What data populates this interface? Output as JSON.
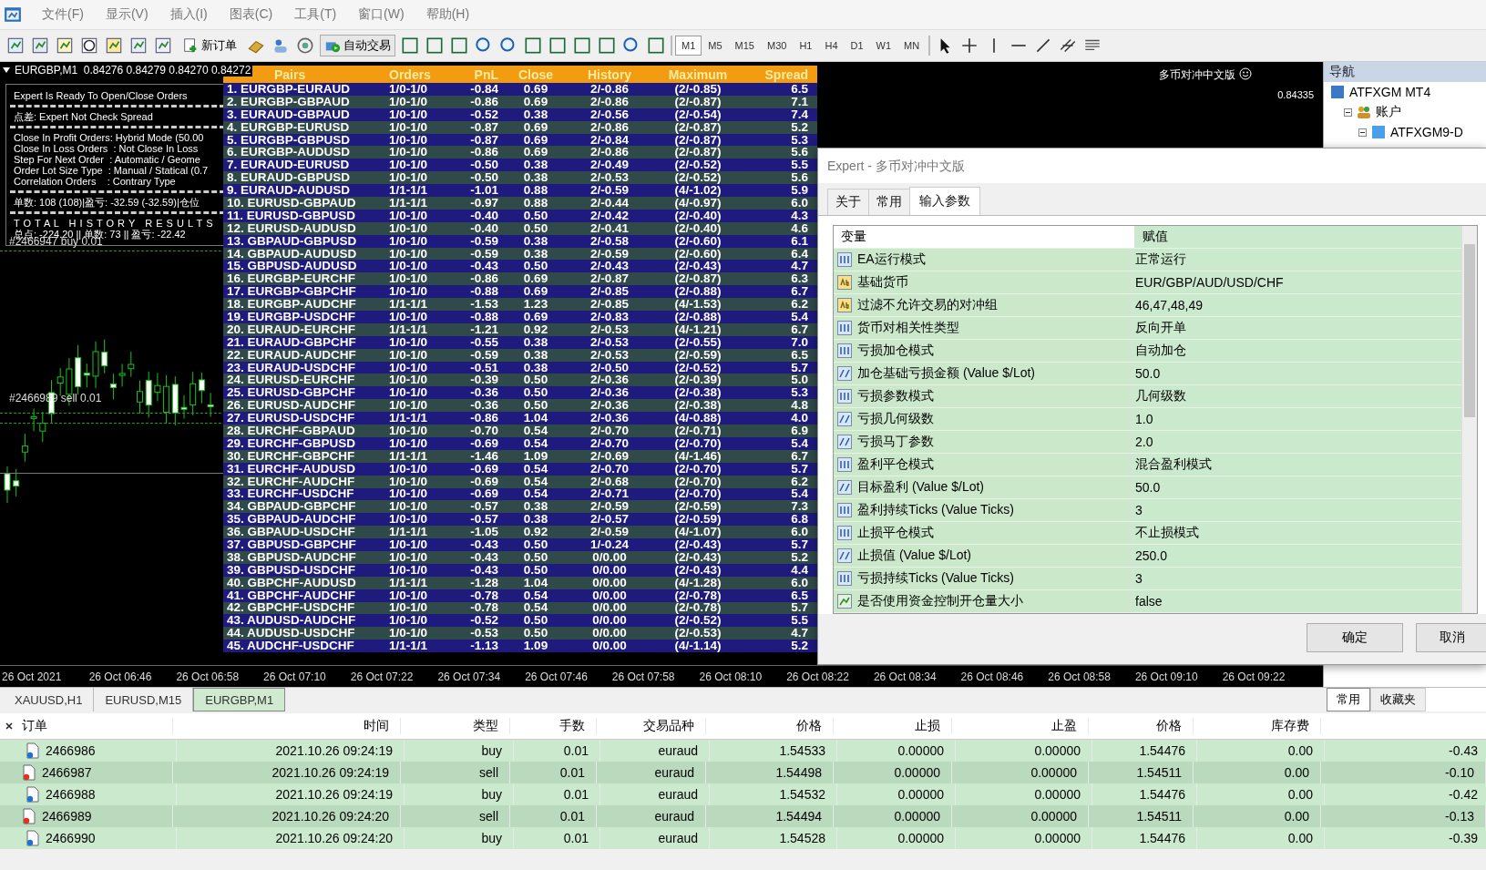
{
  "menu": [
    "文件(F)",
    "显示(V)",
    "插入(I)",
    "图表(C)",
    "工具(T)",
    "窗口(W)",
    "帮助(H)"
  ],
  "toolbar": {
    "new_order": "新订单",
    "auto_trading": "自动交易",
    "timeframes": [
      {
        "label": "M1",
        "selected": true
      },
      {
        "label": "M5",
        "selected": false
      },
      {
        "label": "M15",
        "selected": false
      },
      {
        "label": "M30",
        "selected": false
      },
      {
        "label": "H1",
        "selected": false
      },
      {
        "label": "H4",
        "selected": false
      },
      {
        "label": "D1",
        "selected": false
      },
      {
        "label": "W1",
        "selected": false
      },
      {
        "label": "MN",
        "selected": false
      }
    ]
  },
  "chart": {
    "title": "EURGBP,M1  0.84276 0.84279 0.84270 0.84272",
    "expert_name": "多币对冲中文版",
    "price_label": "0.84335",
    "info_sections": [
      [
        "Expert Is Ready To Open/Close Orders"
      ],
      [
        "点差: Expert Not Check Spread"
      ],
      [
        "Close In Profit Orders: Hybrid Mode (50.00",
        "Close In Loss Orders  : Not Close In Loss",
        "Step For Next Order  : Automatic / Geome",
        "Order Lot Size Type  : Manual / Statical (0.7",
        "Correlation Orders    : Contrary Type"
      ],
      [
        "单数: 108 (108)|盈亏: -32.59 (-32.59)|仓位"
      ],
      [
        "T O T A L   H I S T O R Y   R E S U L T S",
        "总点: -224.20 || 单数: 73 || 盈亏: -22.42"
      ]
    ],
    "order_labels": [
      "#2466947 buy 0.01",
      "#2466989 sell 0.01"
    ],
    "time_labels": [
      "26 Oct 2021",
      "26 Oct 06:46",
      "26 Oct 06:58",
      "26 Oct 07:10",
      "26 Oct 07:22",
      "26 Oct 07:34",
      "26 Oct 07:46",
      "26 Oct 07:58",
      "26 Oct 08:10",
      "26 Oct 08:22",
      "26 Oct 08:34",
      "26 Oct 08:46",
      "26 Oct 08:58",
      "26 Oct 09:10",
      "26 Oct 09:22"
    ],
    "table": {
      "columns": [
        "Pairs",
        "Orders",
        "PnL",
        "Close",
        "History",
        "Maximum",
        "Spread"
      ],
      "rows": [
        [
          "1. EURGBP-EURAUD",
          "1/0-1/0",
          "-0.84",
          "0.69",
          "2/-0.86",
          "(2/-0.85)",
          "6.5"
        ],
        [
          "2. EURGBP-GBPAUD",
          "1/0-1/0",
          "-0.86",
          "0.69",
          "2/-0.86",
          "(2/-0.87)",
          "7.1"
        ],
        [
          "3. EURAUD-GBPAUD",
          "1/0-1/0",
          "-0.52",
          "0.38",
          "2/-0.56",
          "(2/-0.54)",
          "7.4"
        ],
        [
          "4. EURGBP-EURUSD",
          "1/0-1/0",
          "-0.87",
          "0.69",
          "2/-0.86",
          "(2/-0.87)",
          "5.2"
        ],
        [
          "5. EURGBP-GBPUSD",
          "1/0-1/0",
          "-0.87",
          "0.69",
          "2/-0.84",
          "(2/-0.87)",
          "5.3"
        ],
        [
          "6. EURGBP-AUDUSD",
          "1/0-1/0",
          "-0.86",
          "0.69",
          "2/-0.86",
          "(2/-0.87)",
          "5.6"
        ],
        [
          "7. EURAUD-EURUSD",
          "1/0-1/0",
          "-0.50",
          "0.38",
          "2/-0.49",
          "(2/-0.52)",
          "5.5"
        ],
        [
          "8. EURAUD-GBPUSD",
          "1/0-1/0",
          "-0.50",
          "0.38",
          "2/-0.53",
          "(2/-0.52)",
          "5.6"
        ],
        [
          "9. EURAUD-AUDUSD",
          "1/1-1/1",
          "-1.01",
          "0.88",
          "2/-0.59",
          "(4/-1.02)",
          "5.9"
        ],
        [
          "10. EURUSD-GBPAUD",
          "1/1-1/1",
          "-0.97",
          "0.88",
          "2/-0.44",
          "(4/-0.97)",
          "6.0"
        ],
        [
          "11. EURUSD-GBPUSD",
          "1/0-1/0",
          "-0.40",
          "0.50",
          "2/-0.42",
          "(2/-0.40)",
          "4.3"
        ],
        [
          "12. EURUSD-AUDUSD",
          "1/0-1/0",
          "-0.40",
          "0.50",
          "2/-0.41",
          "(2/-0.40)",
          "4.6"
        ],
        [
          "13. GBPAUD-GBPUSD",
          "1/0-1/0",
          "-0.59",
          "0.38",
          "2/-0.58",
          "(2/-0.60)",
          "6.1"
        ],
        [
          "14. GBPAUD-AUDUSD",
          "1/0-1/0",
          "-0.59",
          "0.38",
          "2/-0.59",
          "(2/-0.60)",
          "6.4"
        ],
        [
          "15. GBPUSD-AUDUSD",
          "1/0-1/0",
          "-0.43",
          "0.50",
          "2/-0.43",
          "(2/-0.43)",
          "4.7"
        ],
        [
          "16. EURGBP-EURCHF",
          "1/0-1/0",
          "-0.86",
          "0.69",
          "2/-0.87",
          "(2/-0.87)",
          "6.3"
        ],
        [
          "17. EURGBP-GBPCHF",
          "1/0-1/0",
          "-0.88",
          "0.69",
          "2/-0.85",
          "(2/-0.88)",
          "6.7"
        ],
        [
          "18. EURGBP-AUDCHF",
          "1/1-1/1",
          "-1.53",
          "1.23",
          "2/-0.85",
          "(4/-1.53)",
          "6.2"
        ],
        [
          "19. EURGBP-USDCHF",
          "1/0-1/0",
          "-0.88",
          "0.69",
          "2/-0.83",
          "(2/-0.88)",
          "5.4"
        ],
        [
          "20. EURAUD-EURCHF",
          "1/1-1/1",
          "-1.21",
          "0.92",
          "2/-0.53",
          "(4/-1.21)",
          "6.7"
        ],
        [
          "21. EURAUD-GBPCHF",
          "1/0-1/0",
          "-0.55",
          "0.38",
          "2/-0.53",
          "(2/-0.55)",
          "7.0"
        ],
        [
          "22. EURAUD-AUDCHF",
          "1/0-1/0",
          "-0.59",
          "0.38",
          "2/-0.53",
          "(2/-0.59)",
          "6.5"
        ],
        [
          "23. EURAUD-USDCHF",
          "1/0-1/0",
          "-0.51",
          "0.38",
          "2/-0.50",
          "(2/-0.52)",
          "5.7"
        ],
        [
          "24. EURUSD-EURCHF",
          "1/0-1/0",
          "-0.39",
          "0.50",
          "2/-0.36",
          "(2/-0.39)",
          "5.0"
        ],
        [
          "25. EURUSD-GBPCHF",
          "1/0-1/0",
          "-0.36",
          "0.50",
          "2/-0.36",
          "(2/-0.38)",
          "5.3"
        ],
        [
          "26. EURUSD-AUDCHF",
          "1/0-1/0",
          "-0.36",
          "0.50",
          "2/-0.36",
          "(2/-0.38)",
          "4.8"
        ],
        [
          "27. EURUSD-USDCHF",
          "1/1-1/1",
          "-0.86",
          "1.04",
          "2/-0.36",
          "(4/-0.88)",
          "4.0"
        ],
        [
          "28. EURCHF-GBPAUD",
          "1/0-1/0",
          "-0.70",
          "0.54",
          "2/-0.70",
          "(2/-0.71)",
          "6.9"
        ],
        [
          "29. EURCHF-GBPUSD",
          "1/0-1/0",
          "-0.69",
          "0.54",
          "2/-0.70",
          "(2/-0.70)",
          "5.4"
        ],
        [
          "30. EURCHF-GBPCHF",
          "1/1-1/1",
          "-1.46",
          "1.09",
          "2/-0.69",
          "(4/-1.46)",
          "6.7"
        ],
        [
          "31. EURCHF-AUDUSD",
          "1/0-1/0",
          "-0.69",
          "0.54",
          "2/-0.70",
          "(2/-0.70)",
          "5.7"
        ],
        [
          "32. EURCHF-AUDCHF",
          "1/0-1/0",
          "-0.69",
          "0.54",
          "2/-0.68",
          "(2/-0.70)",
          "6.2"
        ],
        [
          "33. EURCHF-USDCHF",
          "1/0-1/0",
          "-0.69",
          "0.54",
          "2/-0.71",
          "(2/-0.70)",
          "5.4"
        ],
        [
          "34. GBPAUD-GBPCHF",
          "1/0-1/0",
          "-0.57",
          "0.38",
          "2/-0.59",
          "(2/-0.59)",
          "7.3"
        ],
        [
          "35. GBPAUD-AUDCHF",
          "1/0-1/0",
          "-0.57",
          "0.38",
          "2/-0.57",
          "(2/-0.59)",
          "6.8"
        ],
        [
          "36. GBPAUD-USDCHF",
          "1/1-1/1",
          "-1.05",
          "0.92",
          "2/-0.59",
          "(4/-1.07)",
          "6.0"
        ],
        [
          "37. GBPUSD-GBPCHF",
          "1/0-1/0",
          "-0.43",
          "0.50",
          "1/-0.24",
          "(2/-0.43)",
          "5.7"
        ],
        [
          "38. GBPUSD-AUDCHF",
          "1/0-1/0",
          "-0.43",
          "0.50",
          "0/0.00",
          "(2/-0.43)",
          "5.2"
        ],
        [
          "39. GBPUSD-USDCHF",
          "1/0-1/0",
          "-0.43",
          "0.50",
          "0/0.00",
          "(2/-0.43)",
          "4.4"
        ],
        [
          "40. GBPCHF-AUDUSD",
          "1/1-1/1",
          "-1.28",
          "1.04",
          "0/0.00",
          "(4/-1.28)",
          "6.0"
        ],
        [
          "41. GBPCHF-AUDCHF",
          "1/0-1/0",
          "-0.78",
          "0.54",
          "0/0.00",
          "(2/-0.78)",
          "6.5"
        ],
        [
          "42. GBPCHF-USDCHF",
          "1/0-1/0",
          "-0.78",
          "0.54",
          "0/0.00",
          "(2/-0.78)",
          "5.7"
        ],
        [
          "43. AUDUSD-AUDCHF",
          "1/0-1/0",
          "-0.52",
          "0.50",
          "0/0.00",
          "(2/-0.52)",
          "5.5"
        ],
        [
          "44. AUDUSD-USDCHF",
          "1/0-1/0",
          "-0.53",
          "0.50",
          "0/0.00",
          "(2/-0.53)",
          "4.7"
        ],
        [
          "45. AUDCHF-USDCHF",
          "1/1-1/1",
          "-1.13",
          "1.09",
          "0/0.00",
          "(4/-1.14)",
          "5.2"
        ]
      ]
    }
  },
  "chart_tabs": [
    {
      "label": "XAUUSD,H1",
      "selected": false
    },
    {
      "label": "EURUSD,M15",
      "selected": false
    },
    {
      "label": "EURGBP,M1",
      "selected": true
    }
  ],
  "navigator": {
    "title": "导航",
    "tree": [
      {
        "label": "ATFXGM MT4",
        "children": [
          {
            "label": "账户",
            "expanded": true,
            "children": [
              {
                "label": "ATFXGM9-D",
                "expanded": true
              }
            ]
          }
        ]
      }
    ],
    "tabs": [
      {
        "label": "常用",
        "selected": true
      },
      {
        "label": "收藏夹",
        "selected": false
      }
    ]
  },
  "dialog": {
    "title": "Expert - 多币对冲中文版",
    "tabs": [
      {
        "label": "关于",
        "selected": false
      },
      {
        "label": "常用",
        "selected": false
      },
      {
        "label": "输入参数",
        "selected": true
      }
    ],
    "columns": [
      "变量",
      "赋值"
    ],
    "params": [
      {
        "kind": "int",
        "name": "EA运行模式",
        "value": "正常运行"
      },
      {
        "kind": "string",
        "name": "基础货币",
        "value": "EUR/GBP/AUD/USD/CHF"
      },
      {
        "kind": "string",
        "name": "过滤不允许交易的对冲组",
        "value": "46,47,48,49"
      },
      {
        "kind": "int",
        "name": "货币对相关性类型",
        "value": "反向开单"
      },
      {
        "kind": "int",
        "name": "亏损加仓模式",
        "value": "自动加仓"
      },
      {
        "kind": "double",
        "name": "加仓基础亏损金额 (Value $/Lot)",
        "value": "50.0"
      },
      {
        "kind": "int",
        "name": "亏损参数模式",
        "value": "几何级数"
      },
      {
        "kind": "double",
        "name": "亏损几何级数",
        "value": "1.0"
      },
      {
        "kind": "double",
        "name": "亏损马丁参数",
        "value": "2.0"
      },
      {
        "kind": "int",
        "name": "盈利平仓模式",
        "value": "混合盈利模式"
      },
      {
        "kind": "double",
        "name": "目标盈利 (Value $/Lot)",
        "value": "50.0"
      },
      {
        "kind": "int",
        "name": "盈利持续Ticks (Value Ticks)",
        "value": "3"
      },
      {
        "kind": "int",
        "name": "止损平仓模式",
        "value": "不止损模式"
      },
      {
        "kind": "double",
        "name": "止损值 (Value $/Lot)",
        "value": "250.0"
      },
      {
        "kind": "int",
        "name": "亏损持续Ticks (Value Ticks)",
        "value": "3"
      },
      {
        "kind": "bool",
        "name": "是否使用资金控制开仓量大小",
        "value": "false"
      }
    ],
    "buttons": [
      "确定",
      "取消"
    ]
  },
  "terminal": {
    "columns": [
      "订单",
      "时间",
      "类型",
      "手数",
      "交易品种",
      "价格",
      "止损",
      "止盈",
      "价格",
      "库存费"
    ],
    "rows": [
      {
        "kind": "buy",
        "cells": [
          "2466986",
          "2021.10.26 09:24:19",
          "buy",
          "0.01",
          "euraud",
          "1.54533",
          "0.00000",
          "0.00000",
          "1.54476",
          "0.00",
          "-0.43"
        ]
      },
      {
        "kind": "sell",
        "cells": [
          "2466987",
          "2021.10.26 09:24:19",
          "sell",
          "0.01",
          "euraud",
          "1.54498",
          "0.00000",
          "0.00000",
          "1.54511",
          "0.00",
          "-0.10"
        ]
      },
      {
        "kind": "buy",
        "cells": [
          "2466988",
          "2021.10.26 09:24:19",
          "buy",
          "0.01",
          "euraud",
          "1.54532",
          "0.00000",
          "0.00000",
          "1.54476",
          "0.00",
          "-0.42"
        ]
      },
      {
        "kind": "sell",
        "cells": [
          "2466989",
          "2021.10.26 09:24:20",
          "sell",
          "0.01",
          "euraud",
          "1.54494",
          "0.00000",
          "0.00000",
          "1.54511",
          "0.00",
          "-0.13"
        ]
      },
      {
        "kind": "buy",
        "cells": [
          "2466990",
          "2021.10.26 09:24:20",
          "buy",
          "0.01",
          "euraud",
          "1.54528",
          "0.00000",
          "0.00000",
          "1.54476",
          "0.00",
          "-0.39"
        ]
      }
    ]
  }
}
